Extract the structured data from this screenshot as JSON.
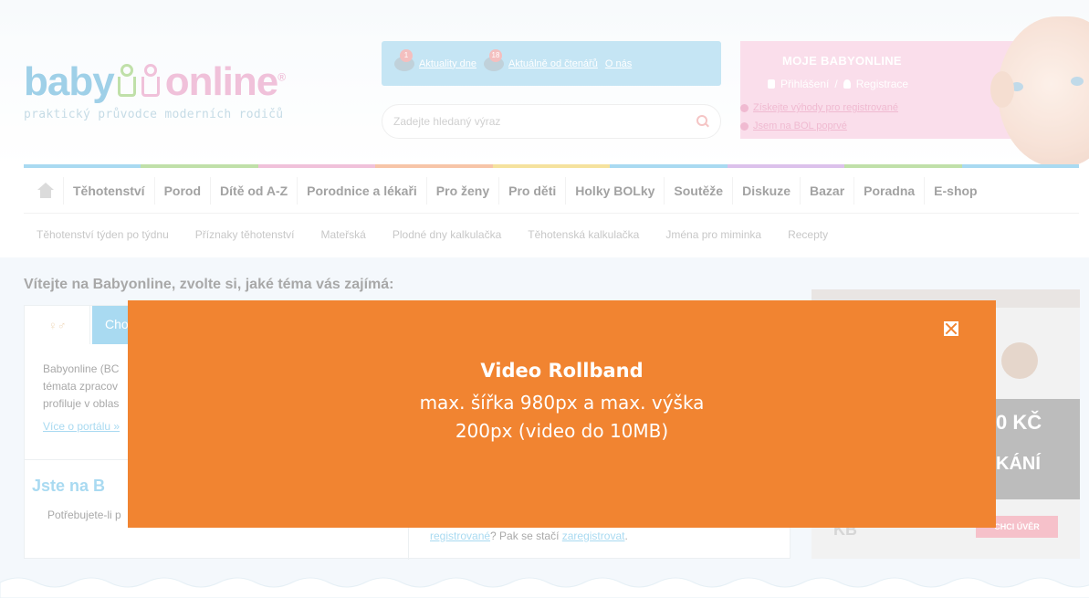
{
  "logo": {
    "baby": "baby",
    "online": "online",
    "reg": "®",
    "tagline": "praktický průvodce moderních rodičů"
  },
  "topbox": {
    "news_badge": "1",
    "news_label": "Aktuality dne",
    "readers_badge": "18",
    "readers_label": "Aktuálně od čtenářů",
    "about_label": "O nás"
  },
  "search": {
    "placeholder": "Zadejte hledaný výraz"
  },
  "account": {
    "title": "MOJE BABYONLINE",
    "login": "Přihlášení",
    "separator": "/",
    "register": "Registrace",
    "benefits_link": "Získejte výhody pro registrované",
    "first_time_link": "Jsem na BOL poprvé"
  },
  "nav": {
    "colors": [
      "#7cc7ea",
      "#9ed07c",
      "#e9a0c6",
      "#f3a77a",
      "#f0d36a",
      "#7cc7ea",
      "#c9a0e0",
      "#9ed07c",
      "#7cc7ea"
    ],
    "items": [
      "Těhotenství",
      "Porod",
      "Dítě od A-Z",
      "Porodnice a lékaři",
      "Pro ženy",
      "Pro děti",
      "Holky BOLky",
      "Soutěže",
      "Diskuze",
      "Bazar",
      "Poradna",
      "E-shop"
    ]
  },
  "subnav": {
    "items": [
      "Těhotenství týden po týdnu",
      "Příznaky těhotenství",
      "Mateřská",
      "Plodné dny kalkulačka",
      "Těhotenská kalkulačka",
      "Jména pro miminka",
      "Recepty"
    ]
  },
  "main": {
    "welcome": "Vítejte na Babyonline, zvolte si, jaké téma vás zajímá:",
    "tab2_label": "Cho",
    "intro_lines": [
      "Babyonline (BC",
      "témata zpracov",
      "profiluje v oblas"
    ],
    "more_link": "Více o portálu »",
    "jste": "Jste na B",
    "potrebujete": "Potřebujete-li p",
    "reg_prefix": "",
    "reg_link1": "registrované",
    "reg_middle": "? Pak se stačí ",
    "reg_link2": "zaregistrovat",
    "reg_suffix": "."
  },
  "ad": {
    "kc": "0 KČ",
    "kani": "KÁNÍ",
    "button": "CHCI ÚVĚR",
    "brand": "KB"
  },
  "modal": {
    "title": "Video Rollband",
    "line1": "max. šířka 980px a max. výška",
    "line2": "200px (video do 10MB)",
    "accent": "#f18431"
  }
}
